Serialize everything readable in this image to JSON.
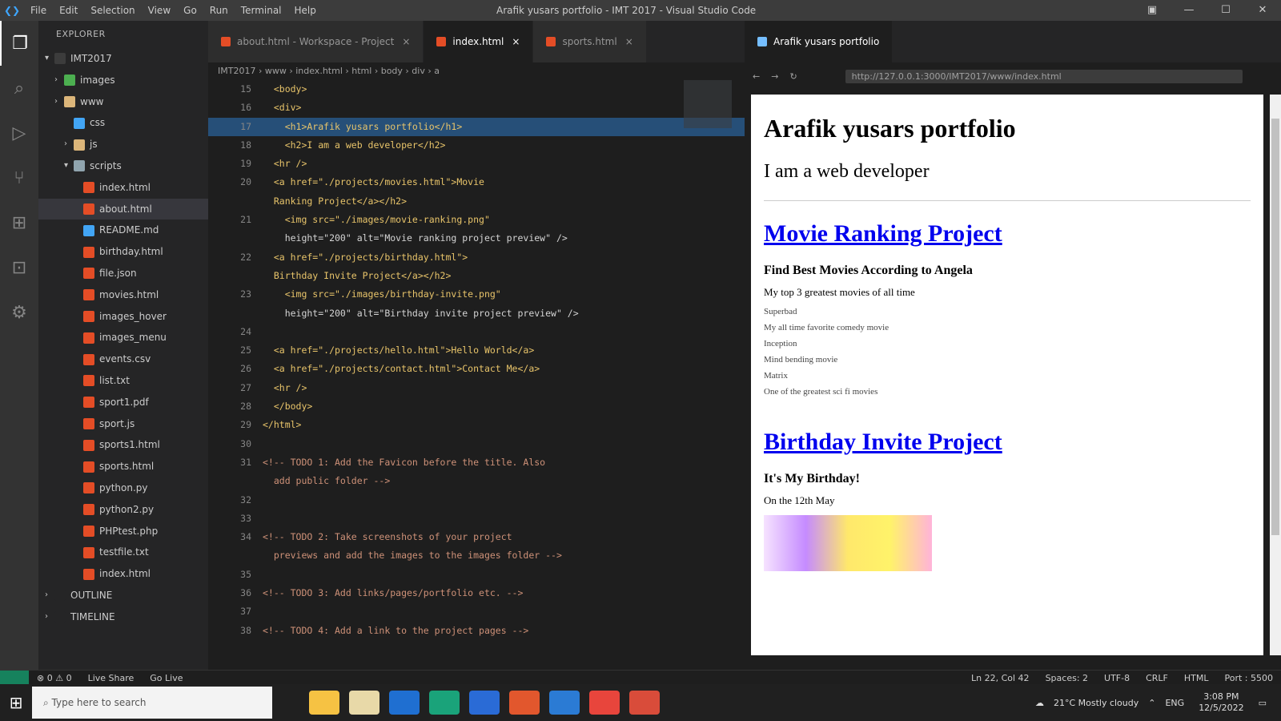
{
  "window": {
    "title": "Arafik yusars portfolio - IMT 2017 - Visual Studio Code",
    "menu": [
      "File",
      "Edit",
      "Selection",
      "View",
      "Go",
      "Run",
      "Terminal",
      "Help"
    ]
  },
  "activity_bar": [
    "files-icon",
    "search-icon",
    "run-icon",
    "git-icon",
    "extensions-icon",
    "remote-icon",
    "settings-icon"
  ],
  "sidebar": {
    "title": "EXPLORER",
    "items": [
      {
        "label": "IMT2017",
        "depth": 0,
        "icon_color": "#3c3c3c",
        "twist": "▾"
      },
      {
        "label": "images",
        "depth": 1,
        "icon_color": "#4caf50",
        "twist": "›"
      },
      {
        "label": "www",
        "depth": 1,
        "icon_color": "#dcb67a",
        "twist": "›"
      },
      {
        "label": "css",
        "depth": 2,
        "icon_color": "#42a5f5",
        "twist": ""
      },
      {
        "label": "js",
        "depth": 2,
        "icon_color": "#dcb67a",
        "twist": "›"
      },
      {
        "label": "scripts",
        "depth": 2,
        "icon_color": "#90a4ae",
        "twist": "▾"
      },
      {
        "label": "index.html",
        "depth": 3,
        "icon_color": "#e44d26",
        "twist": ""
      },
      {
        "label": "about.html",
        "depth": 3,
        "icon_color": "#e44d26",
        "twist": ""
      },
      {
        "label": "README.md",
        "depth": 3,
        "icon_color": "#42a5f5",
        "twist": ""
      },
      {
        "label": "birthday.html",
        "depth": 3,
        "icon_color": "#e44d26",
        "twist": ""
      },
      {
        "label": "file.json",
        "depth": 3,
        "icon_color": "#e44d26",
        "twist": ""
      },
      {
        "label": "movies.html",
        "depth": 3,
        "icon_color": "#e44d26",
        "twist": ""
      },
      {
        "label": "images_hover",
        "depth": 3,
        "icon_color": "#e44d26",
        "twist": ""
      },
      {
        "label": "images_menu",
        "depth": 3,
        "icon_color": "#e44d26",
        "twist": ""
      },
      {
        "label": "events.csv",
        "depth": 3,
        "icon_color": "#e44d26",
        "twist": ""
      },
      {
        "label": "list.txt",
        "depth": 3,
        "icon_color": "#e44d26",
        "twist": ""
      },
      {
        "label": "sport1.pdf",
        "depth": 3,
        "icon_color": "#e44d26",
        "twist": ""
      },
      {
        "label": "sport.js",
        "depth": 3,
        "icon_color": "#e44d26",
        "twist": ""
      },
      {
        "label": "sports1.html",
        "depth": 3,
        "icon_color": "#e44d26",
        "twist": ""
      },
      {
        "label": "sports.html",
        "depth": 3,
        "icon_color": "#e44d26",
        "twist": ""
      },
      {
        "label": "python.py",
        "depth": 3,
        "icon_color": "#e44d26",
        "twist": ""
      },
      {
        "label": "python2.py",
        "depth": 3,
        "icon_color": "#e44d26",
        "twist": ""
      },
      {
        "label": "PHPtest.php",
        "depth": 3,
        "icon_color": "#e44d26",
        "twist": ""
      },
      {
        "label": "testfile.txt",
        "depth": 3,
        "icon_color": "#e44d26",
        "twist": ""
      },
      {
        "label": "index.html",
        "depth": 3,
        "icon_color": "#e44d26",
        "twist": ""
      },
      {
        "label": "OUTLINE",
        "depth": 0,
        "icon_color": "#252526",
        "twist": "›"
      },
      {
        "label": "TIMELINE",
        "depth": 0,
        "icon_color": "#252526",
        "twist": "›"
      }
    ]
  },
  "editor": {
    "tabs": [
      {
        "label": "about.html - Workspace - Project",
        "active": false
      },
      {
        "label": "index.html",
        "active": true
      },
      {
        "label": "sports.html",
        "active": false
      }
    ],
    "breadcrumb": "IMT2017 › www › index.html › html › body › div › a",
    "lines": [
      {
        "n": "15",
        "text": "  <body>"
      },
      {
        "n": "16",
        "text": "  <div>"
      },
      {
        "n": "17",
        "text": "    <h1>Arafik yusars portfolio</h1>"
      },
      {
        "n": "18",
        "text": "    <h2>I am a web developer</h2>"
      },
      {
        "n": "19",
        "text": "  <hr />"
      },
      {
        "n": "20",
        "text": "  <a href=\"./projects/movies.html\">Movie"
      },
      {
        "n": "",
        "text": "  Ranking Project</a></h2>"
      },
      {
        "n": "21",
        "text": "    <img src=\"./images/movie-ranking.png\""
      },
      {
        "n": "",
        "text": "    height=\"200\" alt=\"Movie ranking project preview\" />"
      },
      {
        "n": "22",
        "text": "  <a href=\"./projects/birthday.html\">"
      },
      {
        "n": "",
        "text": "  Birthday Invite Project</a></h2>"
      },
      {
        "n": "23",
        "text": "    <img src=\"./images/birthday-invite.png\""
      },
      {
        "n": "",
        "text": "    height=\"200\" alt=\"Birthday invite project preview\" />"
      },
      {
        "n": "24",
        "text": ""
      },
      {
        "n": "25",
        "text": "  <a href=\"./projects/hello.html\">Hello World</a>"
      },
      {
        "n": "26",
        "text": "  <a href=\"./projects/contact.html\">Contact Me</a>"
      },
      {
        "n": "27",
        "text": "  <hr />"
      },
      {
        "n": "28",
        "text": "  </body>"
      },
      {
        "n": "29",
        "text": "</html>"
      },
      {
        "n": "30",
        "text": ""
      },
      {
        "n": "31",
        "text": "<!-- TODO 1: Add the Favicon before the title. Also"
      },
      {
        "n": "",
        "text": "  add public folder -->"
      },
      {
        "n": "32",
        "text": ""
      },
      {
        "n": "33",
        "text": ""
      },
      {
        "n": "34",
        "text": "<!-- TODO 2: Take screenshots of your project"
      },
      {
        "n": "",
        "text": "  previews and add the images to the images folder -->"
      },
      {
        "n": "35",
        "text": ""
      },
      {
        "n": "36",
        "text": "<!-- TODO 3: Add links/pages/portfolio etc. -->"
      },
      {
        "n": "37",
        "text": ""
      },
      {
        "n": "38",
        "text": "<!-- TODO 4: Add a link to the project pages -->"
      }
    ]
  },
  "preview": {
    "tab_label": "Arafik yusars portfolio",
    "url": "http://127.0.0.1:3000/IMT2017/www/index.html",
    "h1": "Arafik yusars portfolio",
    "h2": "I am a web developer",
    "project1": {
      "link": "Movie Ranking Project",
      "title": "Find Best Movies According to Angela",
      "subtitle": "My top 3 greatest movies of all time",
      "items": [
        "Superbad",
        "My all time favorite comedy movie",
        "Inception",
        "Mind bending movie",
        "Matrix",
        "One of the greatest sci fi movies"
      ]
    },
    "project2": {
      "link": "Birthday Invite Project",
      "title": "It's My Birthday!",
      "subtitle": "On the 12th May"
    }
  },
  "statusbar": {
    "items": [
      "⊗ 0 ⚠ 0",
      "Live Share",
      "Go Live",
      "Ln 22, Col 42",
      "Spaces: 2",
      "UTF-8",
      "CRLF",
      "HTML",
      "Port : 5500"
    ]
  },
  "taskbar": {
    "search_placeholder": "Type here to search",
    "weather": "21°C Mostly cloudy",
    "time": "3:08 PM",
    "date": "12/5/2022",
    "lang": "ENG"
  }
}
